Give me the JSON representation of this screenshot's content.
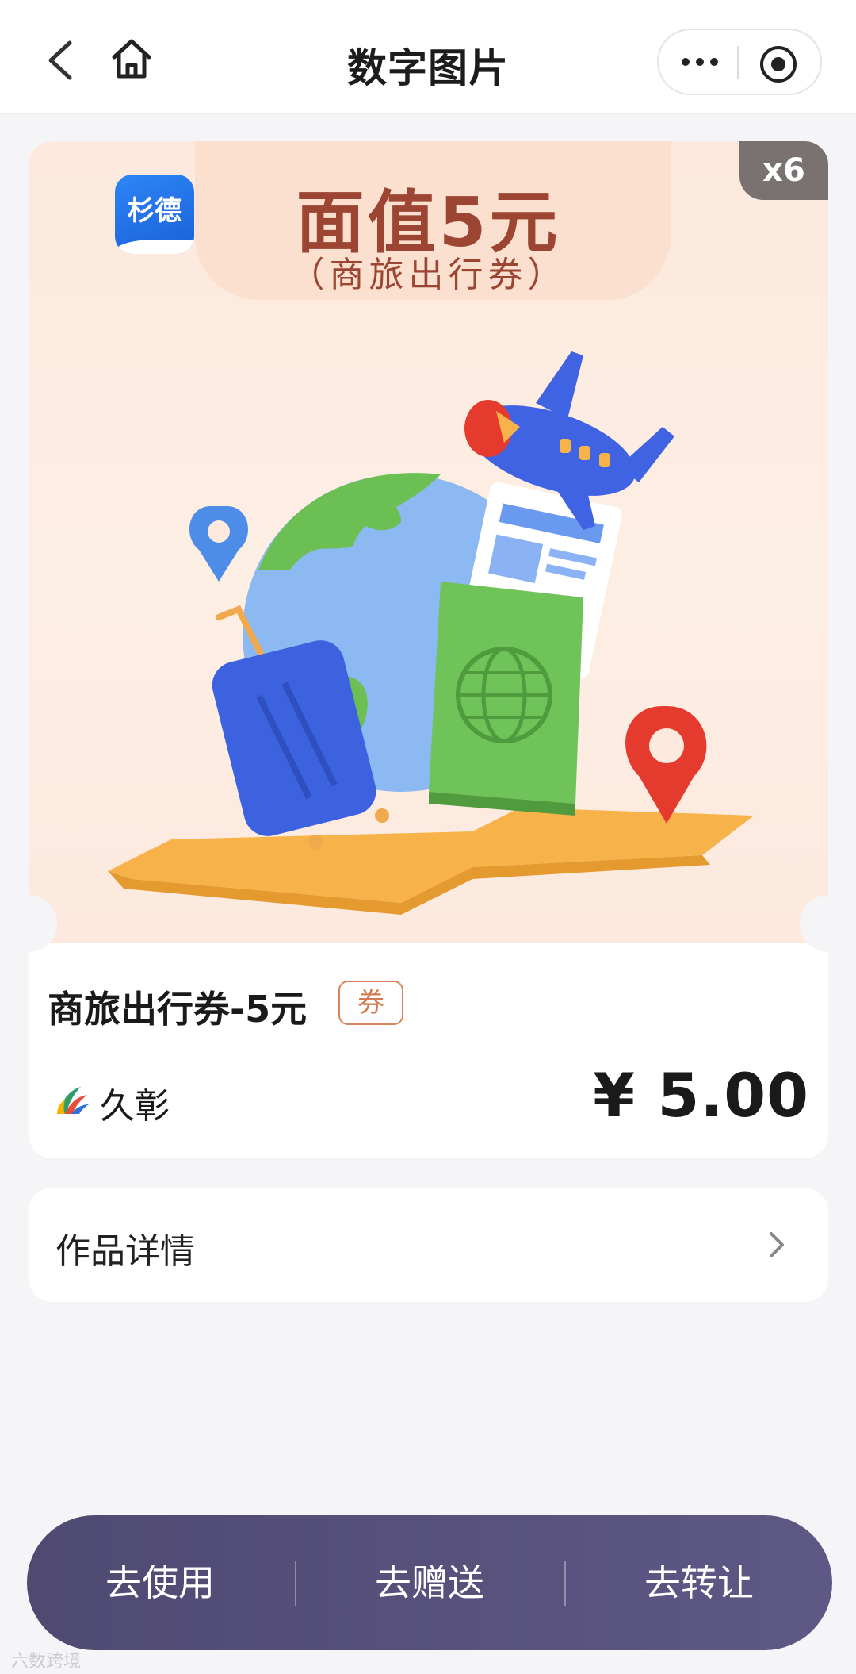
{
  "header": {
    "title": "数字图片"
  },
  "card": {
    "count_badge": "x6",
    "brand_logo": "杉德",
    "banner_title": "面值5元",
    "banner_subtitle": "（商旅出行券）",
    "product_name": "商旅出行券-5元",
    "tag": "券",
    "issuer": "久彰",
    "price": "¥ 5.00"
  },
  "details": {
    "label": "作品详情"
  },
  "actions": {
    "use": "去使用",
    "gift": "去赠送",
    "transfer": "去转让"
  },
  "watermark": "六数跨境",
  "colors": {
    "brand_title": "#9c4532",
    "action_bar": "#4f4a72",
    "tag": "#d57a4e"
  }
}
